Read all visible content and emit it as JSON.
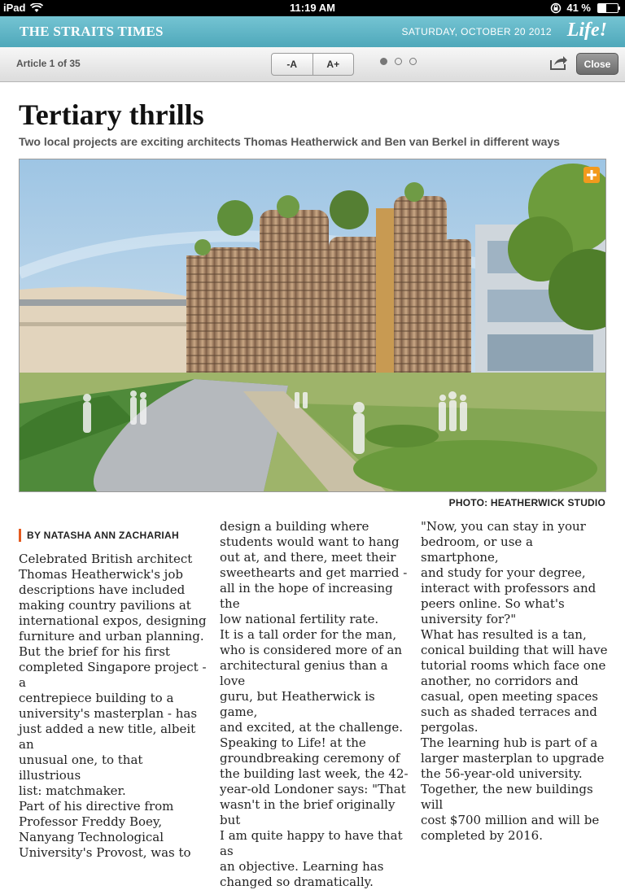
{
  "status_bar": {
    "device": "iPad",
    "time": "11:19 AM",
    "battery": "41 %",
    "battery_level": 0.41
  },
  "masthead": {
    "title": "THE STRAITS TIMES",
    "date": "SATURDAY, OCTOBER 20 2012",
    "section_logo": "Life!"
  },
  "toolbar": {
    "article_count": "Article 1 of 35",
    "font_smaller": "-A",
    "font_larger": "A+",
    "pager_dots": [
      true,
      false,
      false
    ],
    "share_icon": "share-arrow-icon",
    "close": "Close"
  },
  "article": {
    "headline": "Tertiary thrills",
    "subhead": "Two local projects are exciting architects Thomas Heatherwick and Ben van Berkel in different ways",
    "photo_credit": "PHOTO: HEATHERWICK STUDIO",
    "byline": "BY NATASHA ANN ZACHARIAH",
    "columns": [
      "Celebrated British architect\nThomas Heatherwick's job\ndescriptions have included\nmaking country pavilions at\ninternational expos, designing\nfurniture and urban planning.\n But the brief for his first\ncompleted Singapore project - a\ncentrepiece building to a\nuniversity's masterplan - has\njust added a new title, albeit an\nunusual one, to that illustrious\nlist: matchmaker.\n Part of his directive from\nProfessor Freddy Boey,\nNanyang Technological\nUniversity's Provost, was to",
      "design a building where\nstudents would want to hang\nout at, and there, meet their\nsweethearts and get married -\nall in the hope of increasing the\nlow national fertility rate.\n It is a tall order for the man,\nwho is considered more of an\narchitectural genius than a love\nguru, but Heatherwick is game,\nand excited, at the challenge.\n Speaking to Life! at the\ngroundbreaking ceremony of\nthe building last week, the 42-\nyear-old Londoner says: \"That\nwasn't in the brief originally but\nI am quite happy to have that as\nan objective. Learning has\nchanged so dramatically.",
      "\"Now, you can stay in your\nbedroom, or use a smartphone,\nand study for your degree,\ninteract with professors and\npeers online. So what's\nuniversity for?\"\n What has resulted is a tan,\nconical building that will have\ntutorial rooms which face one\nanother, no corridors and\ncasual, open meeting spaces\nsuch as shaded terraces and\npergolas.\n The learning hub is part of a\nlarger masterplan to upgrade\nthe 56-year-old university.\nTogether, the new buildings will\ncost $700 million and will be\ncompleted by 2016."
    ]
  },
  "colors": {
    "masthead": "#5db3c4",
    "byline_accent": "#e45a1f"
  }
}
